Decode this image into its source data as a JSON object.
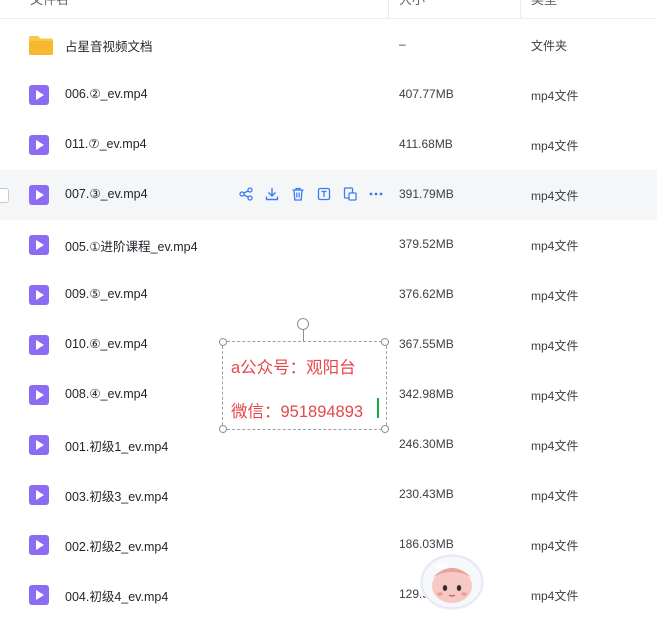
{
  "header": {
    "col_name": "文件名",
    "col_size": "大小",
    "col_type": "类型"
  },
  "rows": [
    {
      "name": "占星音视频文档",
      "size": "–",
      "type": "文件夹",
      "icon": "folder-icon"
    },
    {
      "name": "006.②_ev.mp4",
      "size": "407.77MB",
      "type": "mp4文件",
      "icon": "video-file-icon"
    },
    {
      "name": "011.⑦_ev.mp4",
      "size": "411.68MB",
      "type": "mp4文件",
      "icon": "video-file-icon"
    },
    {
      "name": "007.③_ev.mp4",
      "size": "391.79MB",
      "type": "mp4文件",
      "icon": "video-file-icon"
    },
    {
      "name": "005.①进阶课程_ev.mp4",
      "size": "379.52MB",
      "type": "mp4文件",
      "icon": "video-file-icon"
    },
    {
      "name": "009.⑤_ev.mp4",
      "size": "376.62MB",
      "type": "mp4文件",
      "icon": "video-file-icon"
    },
    {
      "name": "010.⑥_ev.mp4",
      "size": "367.55MB",
      "type": "mp4文件",
      "icon": "video-file-icon"
    },
    {
      "name": "008.④_ev.mp4",
      "size": "342.98MB",
      "type": "mp4文件",
      "icon": "video-file-icon"
    },
    {
      "name": "001.初级1_ev.mp4",
      "size": "246.30MB",
      "type": "mp4文件",
      "icon": "video-file-icon"
    },
    {
      "name": "003.初级3_ev.mp4",
      "size": "230.43MB",
      "type": "mp4文件",
      "icon": "video-file-icon"
    },
    {
      "name": "002.初级2_ev.mp4",
      "size": "186.03MB",
      "type": "mp4文件",
      "icon": "video-file-icon"
    },
    {
      "name": "004.初级4_ev.mp4",
      "size": "129.55MB",
      "type": "mp4文件",
      "icon": "video-file-icon"
    }
  ],
  "hover_actions": [
    "share-icon",
    "download-icon",
    "delete-icon",
    "rename-icon",
    "copy-icon",
    "more-icon"
  ],
  "annotation": {
    "line1": "a公众号：观阳台",
    "line2": "微信：951894893"
  },
  "colors": {
    "video_icon": "#8b6cf3",
    "folder": "#f5c342",
    "action_icon": "#3b7cf5",
    "annotation_text": "#e5474c"
  }
}
